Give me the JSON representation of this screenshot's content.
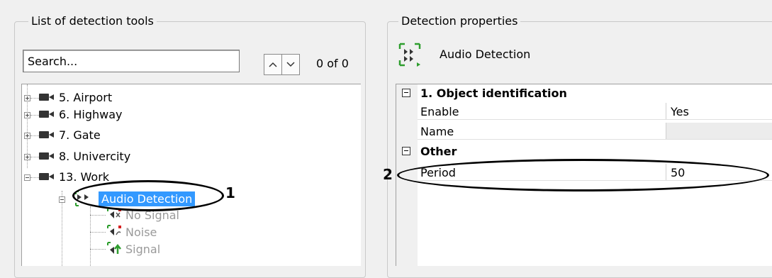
{
  "left_panel": {
    "title": "List of detection tools",
    "search": {
      "placeholder": "Search..."
    },
    "counter": "0 of 0",
    "tree": [
      {
        "label": "5. Airport",
        "state": "collapsed"
      },
      {
        "label": "6. Highway",
        "state": "collapsed"
      },
      {
        "label": "7. Gate",
        "state": "collapsed"
      },
      {
        "label": "8. Univercity",
        "state": "collapsed"
      },
      {
        "label": "13. Work",
        "state": "expanded"
      },
      {
        "label": "Audio Detection",
        "state": "expanded",
        "selected": true
      },
      {
        "label": "No Signal",
        "disabled": true
      },
      {
        "label": "Noise",
        "disabled": true
      },
      {
        "label": "Signal",
        "disabled": true
      }
    ],
    "callout": "1"
  },
  "right_panel": {
    "title": "Detection properties",
    "tool_name": "Audio Detection",
    "categories": [
      {
        "label": "1. Object identification",
        "rows": [
          {
            "name": "Enable",
            "value": "Yes"
          },
          {
            "name": "Name",
            "value": ""
          }
        ]
      },
      {
        "label": "Other",
        "rows": [
          {
            "name": "Period",
            "value": "50"
          }
        ]
      }
    ],
    "callout": "2"
  },
  "colors": {
    "selection": "#3399ff",
    "disabled_text": "#9a9a9a",
    "signal_arrow": "#2e9e2e",
    "marker_red": "#d62020"
  }
}
